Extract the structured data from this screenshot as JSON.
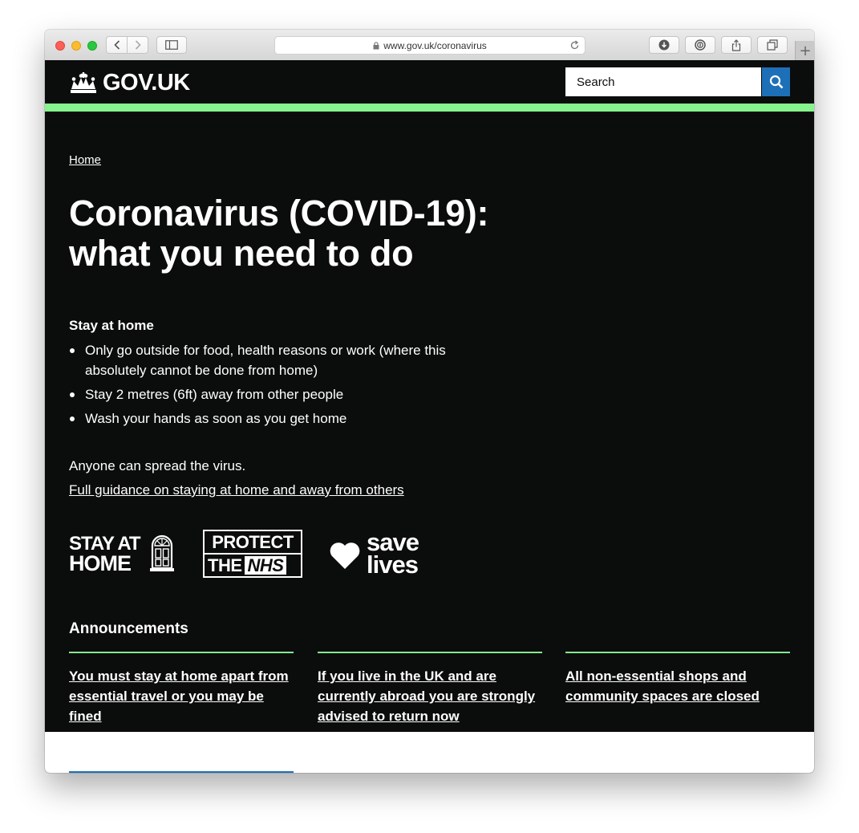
{
  "browser": {
    "url": "www.gov.uk/coronavirus",
    "new_tab_symbol": "+"
  },
  "header": {
    "logo_text": "GOV.UK",
    "search_placeholder": "Search"
  },
  "breadcrumb": {
    "home": "Home"
  },
  "main": {
    "title": "Coronavirus (COVID-19): what you need to do",
    "stay_home_heading": "Stay at home",
    "bullets": [
      "Only go outside for food, health reasons or work (where this absolutely cannot be done from home)",
      "Stay 2 metres (6ft) away from other people",
      "Wash your hands as soon as you get home"
    ],
    "spread_text": "Anyone can spread the virus.",
    "guidance_link": "Full guidance on staying at home and away from others"
  },
  "slogans": {
    "stay_line1": "STAY AT",
    "stay_line2": "HOME",
    "protect_line1": "PROTECT",
    "protect_the": "THE",
    "protect_nhs": "NHS",
    "save_line1": "save",
    "save_line2": "lives"
  },
  "announcements": {
    "heading": "Announcements",
    "items": [
      "You must stay at home apart from essential travel or you may be fined",
      "If you live in the UK and are currently abroad you are strongly advised to return now",
      "All non-essential shops and community spaces are closed"
    ]
  },
  "colors": {
    "page_background": "#0b0c0c",
    "accent_green": "#85f48c",
    "search_button": "#1d70b8"
  }
}
